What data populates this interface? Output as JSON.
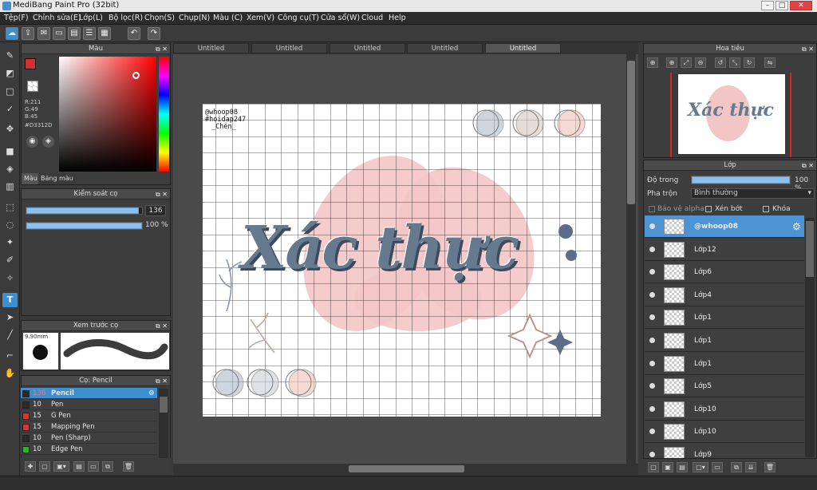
{
  "window": {
    "title": "MediBang Paint Pro (32bit)"
  },
  "menu": [
    "Tệp(F)",
    "Chỉnh sửa(E)",
    "Lớp(L)",
    "Bộ lọc(R)",
    "Chọn(S)",
    "Chụp(N)",
    "Màu (C)",
    "Xem(V)",
    "Công cụ(T)",
    "Cửa sổ(W)",
    "Cloud",
    "Help"
  ],
  "color_panel": {
    "title": "Màu",
    "r": "R:211",
    "g": "G:49",
    "b": "B:45",
    "hex": "#D3312D",
    "tab1": "Màu",
    "tab2": "Bảng màu",
    "fg_color": "#D3312D",
    "bg_color": "#44CC22"
  },
  "brush_control": {
    "title": "Kiểm soát cọ",
    "size": "136",
    "opacity": "100 %",
    "size_fraction": 0.97,
    "opacity_fraction": 1.0
  },
  "brush_preview": {
    "title": "Xem trước cọ",
    "size_label": "9.90mm"
  },
  "brush_list": {
    "title": "Cọ: Pencil",
    "items": [
      {
        "size": "136",
        "name": "Pencil",
        "color": "#2a2a2a",
        "selected": true
      },
      {
        "size": "10",
        "name": "Pen",
        "color": "#2a2a2a"
      },
      {
        "size": "15",
        "name": "G Pen",
        "color": "#e03030"
      },
      {
        "size": "15",
        "name": "Mapping Pen",
        "color": "#e03030"
      },
      {
        "size": "10",
        "name": "Pen (Sharp)",
        "color": "#2a2a2a"
      },
      {
        "size": "10",
        "name": "Edge Pen",
        "color": "#22bb22"
      }
    ]
  },
  "doc_tabs": [
    "Untitled",
    "Untitled",
    "Untitled",
    "Untitled",
    "Untitled"
  ],
  "canvas": {
    "watermark_line1": "@whoop08",
    "watermark_line2": "#hoidap247",
    "watermark_line3": "_Chén_",
    "headline": "Xác thực"
  },
  "navigator": {
    "title": "Hoa tiêu"
  },
  "layer_panel": {
    "title": "Lớp",
    "opacity_label": "Độ trong",
    "opacity_value": "100 %",
    "blend_label": "Pha trộn",
    "blend_value": "Bình thường",
    "protect_alpha": "Bảo vệ alpha",
    "clipping": "Xén bớt",
    "lock": "Khóa",
    "layers": [
      {
        "name": "@whoop08",
        "selected": true
      },
      {
        "name": "Lớp12"
      },
      {
        "name": "Lớp6"
      },
      {
        "name": "Lớp4"
      },
      {
        "name": "Lớp1"
      },
      {
        "name": "Lớp1"
      },
      {
        "name": "Lớp1"
      },
      {
        "name": "Lớp5"
      },
      {
        "name": "Lớp10"
      },
      {
        "name": "Lớp10"
      },
      {
        "name": "Lớp9"
      }
    ]
  }
}
